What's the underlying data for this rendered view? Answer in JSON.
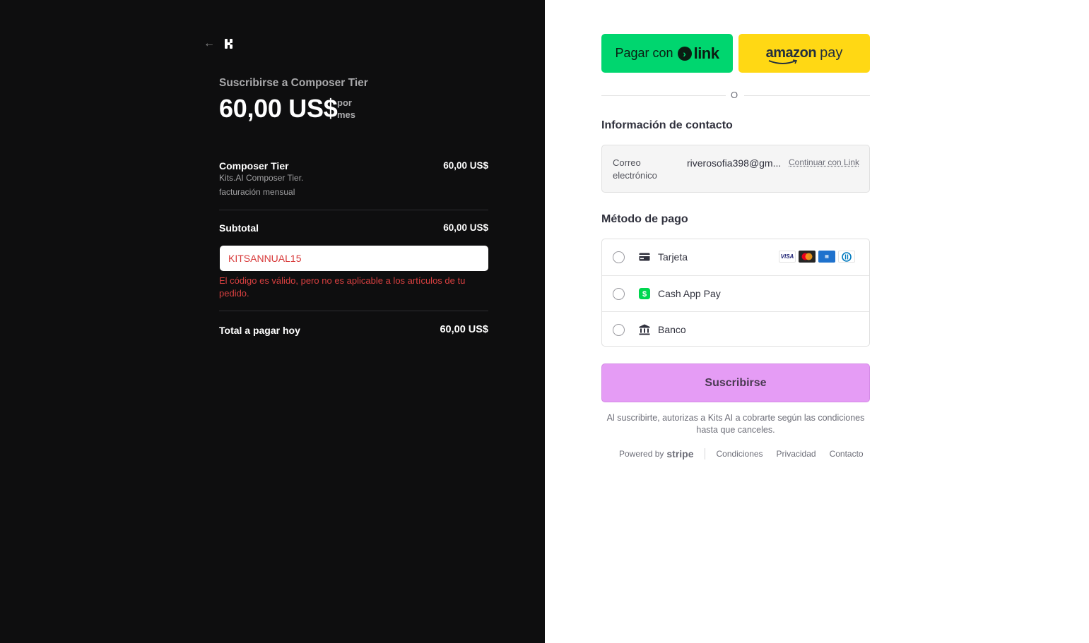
{
  "summary": {
    "back_icon": "arrow-left-icon",
    "logo": "kits-logo",
    "subscribe_to": "Suscribirse a Composer Tier",
    "price": "60,00 US$",
    "per_line1": "por",
    "per_line2": "mes",
    "item": {
      "name": "Composer Tier",
      "description": "Kits.AI Composer Tier.",
      "billing": "facturación mensual",
      "price": "60,00 US$"
    },
    "subtotal_label": "Subtotal",
    "subtotal_value": "60,00 US$",
    "promo_code": "KITSANNUAL15",
    "promo_error": "El código es válido, pero no es aplicable a los artículos de tu pedido.",
    "total_label": "Total a pagar hoy",
    "total_value": "60,00 US$"
  },
  "express": {
    "link_prefix": "Pagar con",
    "link_word": "link",
    "amazon_word": "amazon",
    "amazon_pay": "pay",
    "or_text": "O"
  },
  "contact": {
    "title": "Información de contacto",
    "email_label": "Correo electrónico",
    "email_value": "riverosofia398@gm...",
    "continue_link": "Continuar con Link"
  },
  "payment": {
    "title": "Método de pago",
    "methods": [
      {
        "label": "Tarjeta",
        "icon": "credit-card-icon"
      },
      {
        "label": "Cash App Pay",
        "icon": "cash-app-icon"
      },
      {
        "label": "Banco",
        "icon": "bank-icon"
      }
    ],
    "card_brands": [
      "VISA",
      "Mastercard",
      "AMEX",
      "Diners"
    ]
  },
  "subscribe_button": "Suscribirse",
  "legal_text": "Al suscribirte, autorizas a Kits AI a cobrarte según las condiciones hasta que canceles.",
  "footer": {
    "powered_by": "Powered by",
    "stripe": "stripe",
    "links": [
      "Condiciones",
      "Privacidad",
      "Contacto"
    ]
  },
  "colors": {
    "left_bg": "#0e0e0f",
    "link_green": "#00d66f",
    "amazon_yellow": "#ffd814",
    "subscribe_purple": "#e59cf5",
    "error_red": "#d83a3a"
  }
}
